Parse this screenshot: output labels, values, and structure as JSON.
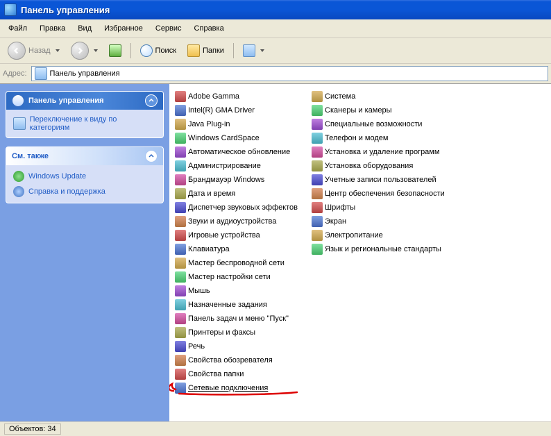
{
  "title": "Панель управления",
  "menu": {
    "file": "Файл",
    "edit": "Правка",
    "view": "Вид",
    "favorites": "Избранное",
    "tools": "Сервис",
    "help": "Справка"
  },
  "toolbar": {
    "back": "Назад",
    "search": "Поиск",
    "folders": "Папки"
  },
  "address": {
    "label": "Адрес:",
    "value": "Панель управления"
  },
  "side": {
    "panel1_title": "Панель управления",
    "panel1_link": "Переключение к виду по категориям",
    "panel2_title": "См. также",
    "panel2_link1": "Windows Update",
    "panel2_link2": "Справка и поддержка"
  },
  "items_left": [
    "Adobe Gamma",
    "Intel(R) GMA Driver",
    "Java Plug-in",
    "Windows CardSpace",
    "Автоматическое обновление",
    "Администрирование",
    "Брандмауэр Windows",
    "Дата и время",
    "Диспетчер звуковых эффектов",
    "Звуки и аудиоустройства",
    "Игровые устройства",
    "Клавиатура",
    "Мастер беспроводной сети",
    "Мастер настройки сети",
    "Мышь",
    "Назначенные задания",
    "Панель задач и меню \"Пуск\"",
    "Принтеры и факсы",
    "Речь",
    "Свойства обозревателя",
    "Свойства папки",
    "Сетевые подключения"
  ],
  "items_right": [
    "Система",
    "Сканеры и камеры",
    "Специальные возможности",
    "Телефон и модем",
    "Установка и удаление программ",
    "Установка оборудования",
    "Учетные записи пользователей",
    "Центр обеспечения безопасности",
    "Шрифты",
    "Экран",
    "Электропитание",
    "Язык и региональные стандарты"
  ],
  "highlighted_index": 21,
  "status": {
    "objects_label": "Объектов:",
    "count": "34"
  }
}
